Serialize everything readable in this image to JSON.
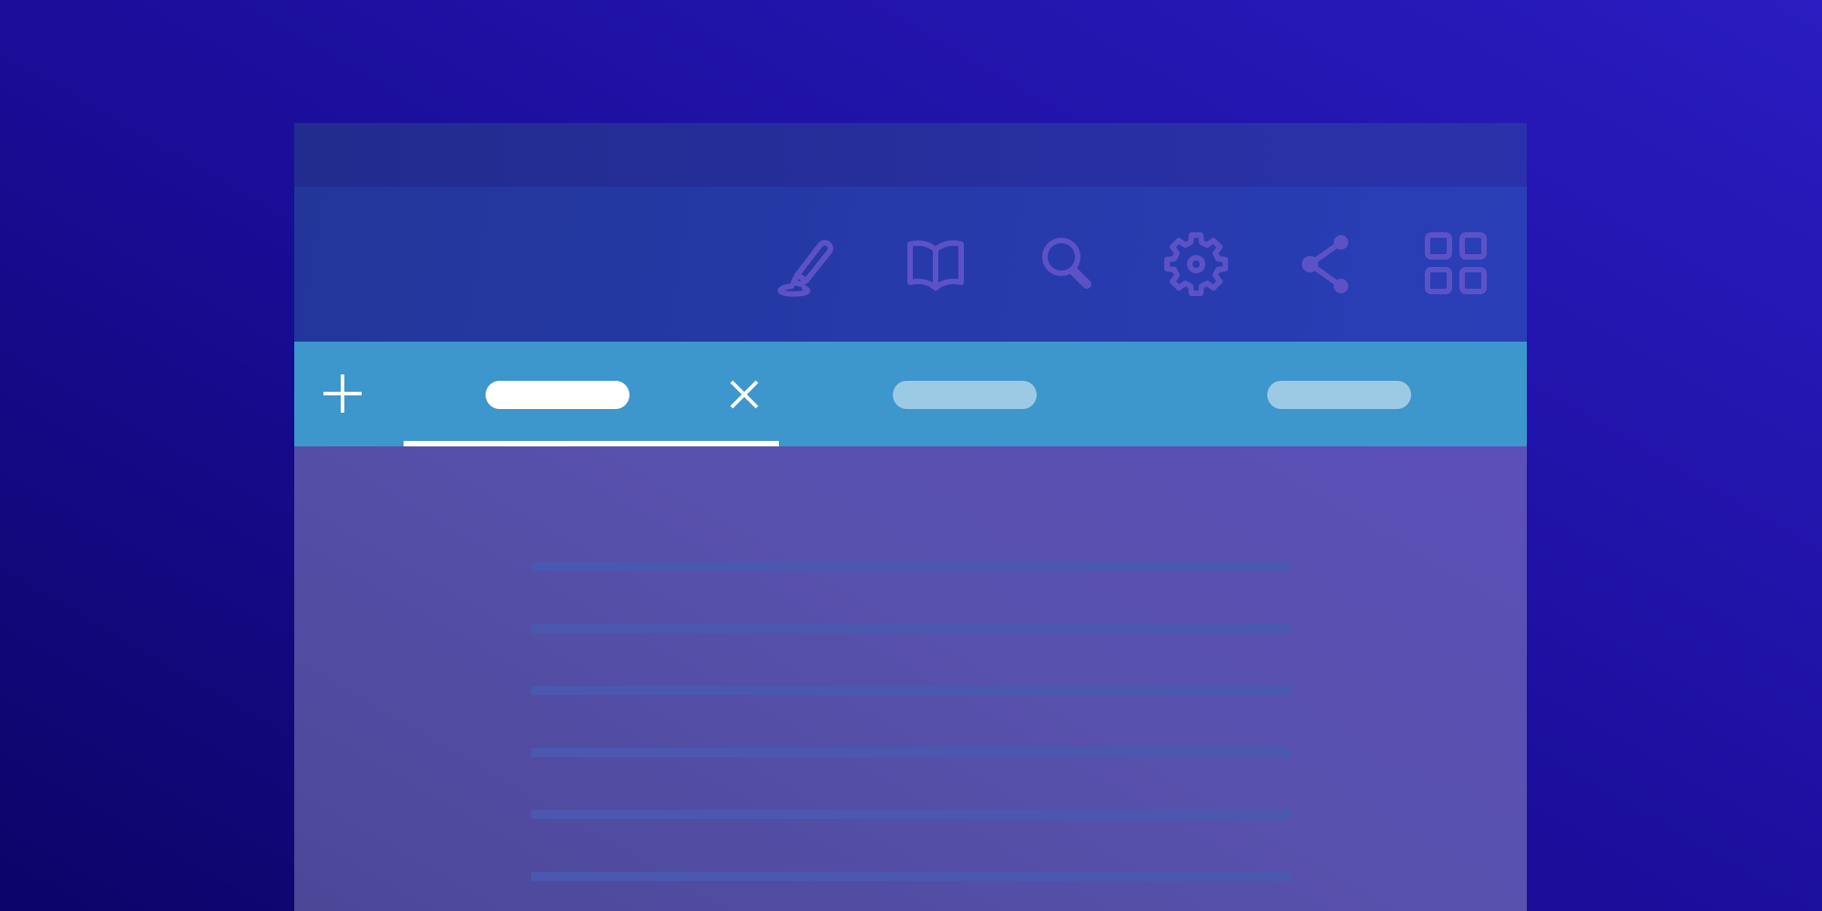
{
  "toolbar": {
    "tools": [
      {
        "name": "highlighter-icon"
      },
      {
        "name": "book-icon"
      },
      {
        "name": "search-icon"
      },
      {
        "name": "gear-icon"
      },
      {
        "name": "share-icon"
      },
      {
        "name": "grid-icon"
      }
    ]
  },
  "tabs": {
    "items": [
      {
        "label": "",
        "active": true
      },
      {
        "label": "",
        "active": false
      },
      {
        "label": "",
        "active": false
      }
    ]
  },
  "colors": {
    "background": "#1a0d98",
    "titlebar": "#2630a0",
    "toolbar": "#2a3bb0",
    "tabbar": "#3d96cc",
    "content": "#5350a8",
    "icon": "#5c52c6",
    "active_tab": "#ffffff",
    "inactive_tab": "#9ccae4",
    "text_placeholder": "#4a58b0"
  }
}
